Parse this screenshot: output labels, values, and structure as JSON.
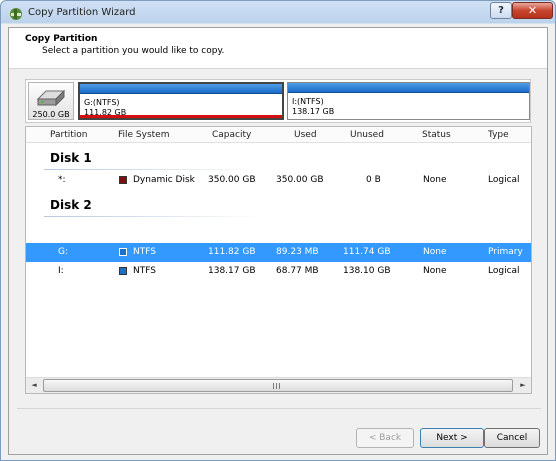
{
  "window": {
    "title": "Copy Partition Wizard",
    "help_label": "?",
    "close_label": "✕"
  },
  "header": {
    "title": "Copy Partition",
    "subtitle": "Select a partition you would like to copy."
  },
  "disk_map": {
    "disk_size": "250.0 GB",
    "partitions": [
      {
        "name": "G:(NTFS)",
        "size": "111.82 GB",
        "selected": true
      },
      {
        "name": "I:(NTFS)",
        "size": "138.17 GB",
        "selected": false
      }
    ]
  },
  "table": {
    "columns": [
      "Partition",
      "File System",
      "Capacity",
      "Used",
      "Unused",
      "Status",
      "Type"
    ],
    "groups": [
      {
        "title": "Disk 1",
        "rows": [
          {
            "partition": "*:",
            "fs": "Dynamic Disk",
            "fs_color": "#7a1010",
            "capacity": "350.00 GB",
            "used": "350.00 GB",
            "unused": "0 B",
            "status": "None",
            "type": "Logical"
          }
        ]
      },
      {
        "title": "Disk 2",
        "rows": [
          {
            "partition": "G:",
            "fs": "NTFS",
            "fs_color": "#1f6fc4",
            "capacity": "111.82 GB",
            "used": "89.23 MB",
            "unused": "111.74 GB",
            "status": "None",
            "type": "Primary"
          },
          {
            "partition": "I:",
            "fs": "NTFS",
            "fs_color": "#1f6fc4",
            "capacity": "138.17 GB",
            "used": "68.77 MB",
            "unused": "138.10 GB",
            "status": "None",
            "type": "Logical"
          }
        ]
      }
    ],
    "selected_row": "G:"
  },
  "scrollbar": {
    "left_arrow": "◄",
    "right_arrow": "►"
  },
  "buttons": {
    "back": "< Back",
    "next": "Next >",
    "cancel": "Cancel"
  }
}
